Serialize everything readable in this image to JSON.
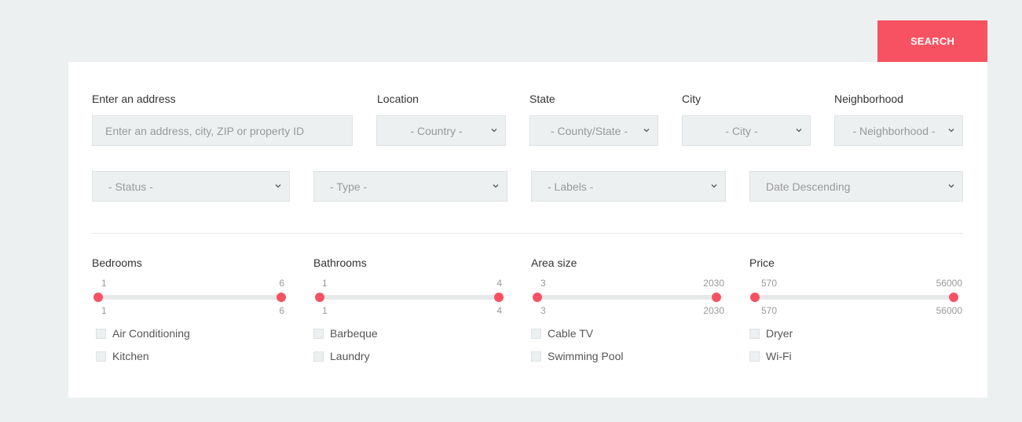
{
  "search_button": {
    "label": "SEARCH"
  },
  "row1": {
    "address": {
      "label": "Enter an address",
      "placeholder": "Enter an address, city, ZIP or property ID"
    },
    "location": {
      "label": "Location",
      "value": "- Country -"
    },
    "state": {
      "label": "State",
      "value": "- County/State -"
    },
    "city": {
      "label": "City",
      "value": "- City -"
    },
    "neighborhood": {
      "label": "Neighborhood",
      "value": "- Neighborhood -"
    }
  },
  "row2": {
    "status": {
      "value": "- Status -"
    },
    "type": {
      "value": "- Type -"
    },
    "labels": {
      "value": "- Labels -"
    },
    "sort": {
      "value": "Date Descending"
    }
  },
  "ranges": [
    {
      "label": "Bedrooms",
      "min": "1",
      "max": "6",
      "low": "1",
      "high": "6"
    },
    {
      "label": "Bathrooms",
      "min": "1",
      "max": "4",
      "low": "1",
      "high": "4"
    },
    {
      "label": "Area size",
      "min": "3",
      "max": "2030",
      "low": "3",
      "high": "2030"
    },
    {
      "label": "Price",
      "min": "570",
      "max": "56000",
      "low": "570",
      "high": "56000"
    }
  ],
  "amenities": [
    [
      "Air Conditioning",
      "Kitchen"
    ],
    [
      "Barbeque",
      "Laundry"
    ],
    [
      "Cable TV",
      "Swimming Pool"
    ],
    [
      "Dryer",
      "Wi-Fi"
    ]
  ],
  "colors": {
    "accent": "#f75262",
    "field_bg": "#edf0f1"
  }
}
